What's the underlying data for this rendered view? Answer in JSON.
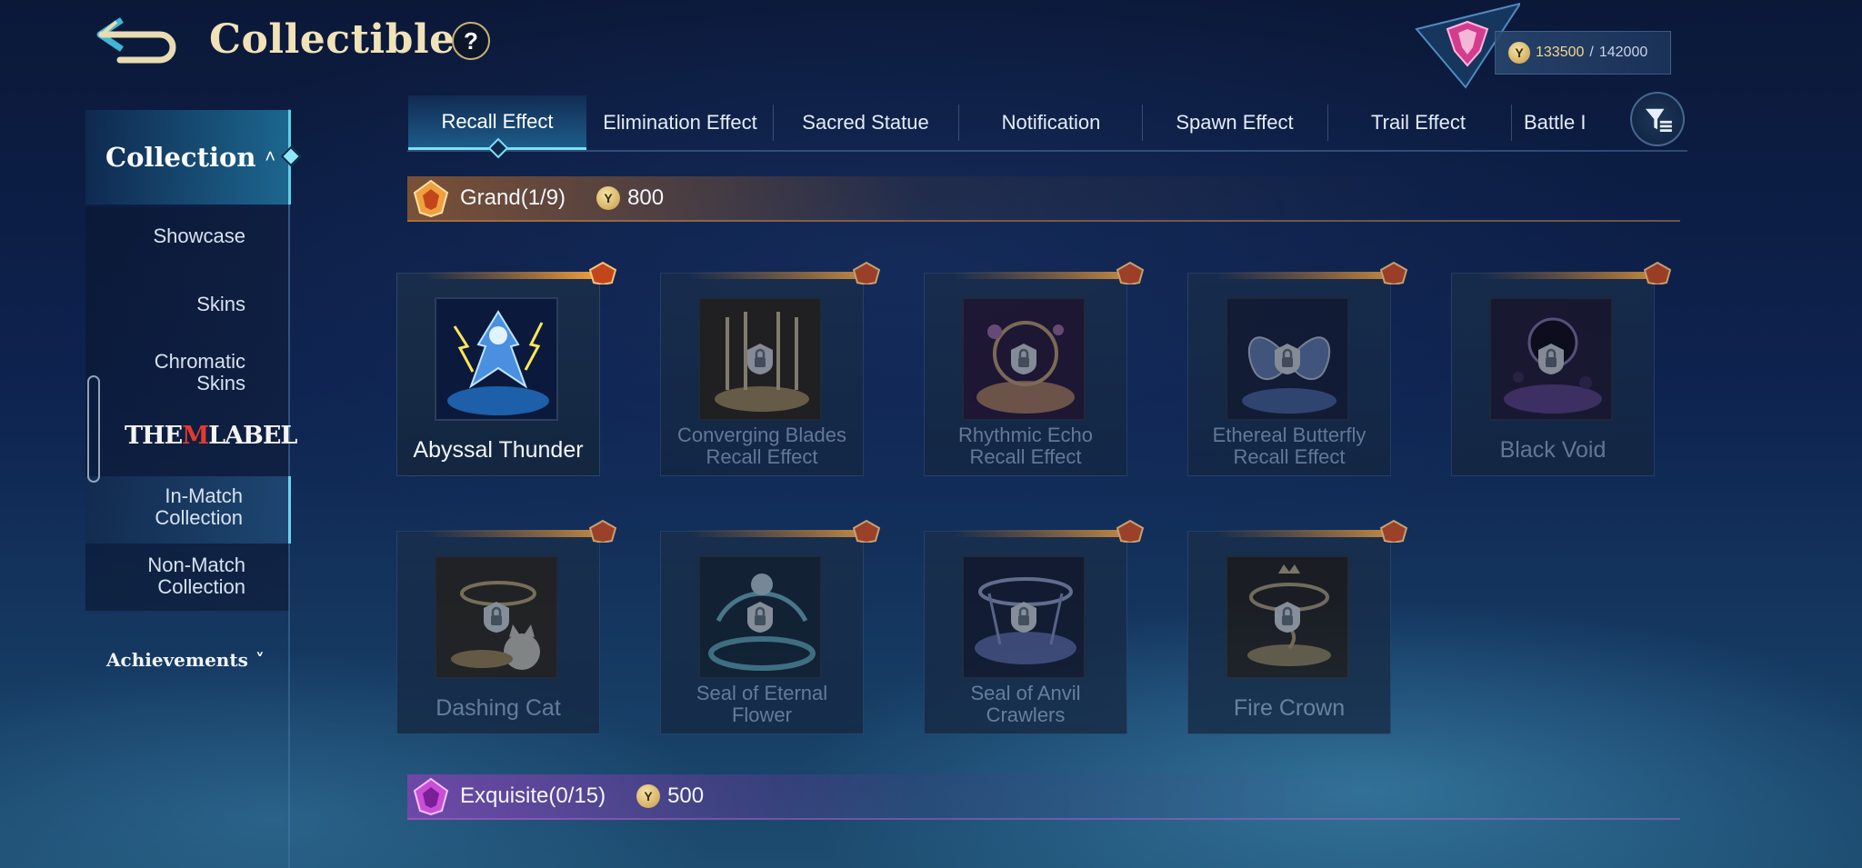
{
  "header": {
    "title": "Collectible",
    "help_label": "?",
    "currency": {
      "current": "133500",
      "separator": "/",
      "max": "142000"
    }
  },
  "sidebar": {
    "collection_label": "Collection",
    "items": [
      {
        "label": "Showcase"
      },
      {
        "label": "Skins"
      },
      {
        "label": "Chromatic Skins"
      },
      {
        "label": "In-Match Collection",
        "active": true
      },
      {
        "label": "Non-Match Collection"
      }
    ],
    "brand_label": {
      "the": "THE",
      "m": "M",
      "label": "LABEL"
    },
    "achievements_label": "Achievements"
  },
  "tabs": [
    {
      "label": "Recall Effect",
      "active": true
    },
    {
      "label": "Elimination Effect"
    },
    {
      "label": "Sacred Statue"
    },
    {
      "label": "Notification"
    },
    {
      "label": "Spawn Effect"
    },
    {
      "label": "Trail Effect"
    },
    {
      "label": "Battle I"
    }
  ],
  "sections": {
    "grand": {
      "label": "Grand(1/9)",
      "price": "800",
      "items": [
        {
          "name": "Abyssal Thunder",
          "locked": false,
          "art": "thunder"
        },
        {
          "name": "Converging Blades Recall Effect",
          "locked": true,
          "art": "blades"
        },
        {
          "name": "Rhythmic Echo Recall Effect",
          "locked": true,
          "art": "echo"
        },
        {
          "name": "Ethereal Butterfly Recall Effect",
          "locked": true,
          "art": "butterfly"
        },
        {
          "name": "Black Void",
          "locked": true,
          "art": "void"
        },
        {
          "name": "Dashing Cat",
          "locked": true,
          "art": "cat"
        },
        {
          "name": "Seal of Eternal Flower",
          "locked": true,
          "art": "flower"
        },
        {
          "name": "Seal of Anvil Crawlers",
          "locked": true,
          "art": "anvil"
        },
        {
          "name": "Fire Crown",
          "locked": true,
          "art": "crown"
        }
      ]
    },
    "exquisite": {
      "label": "Exquisite(0/15)",
      "price": "500"
    }
  },
  "colors": {
    "accent": "#7ee0f2",
    "gold": "#f1e2b7",
    "grand": "#d27828",
    "exquisite": "#aa3cc8"
  }
}
